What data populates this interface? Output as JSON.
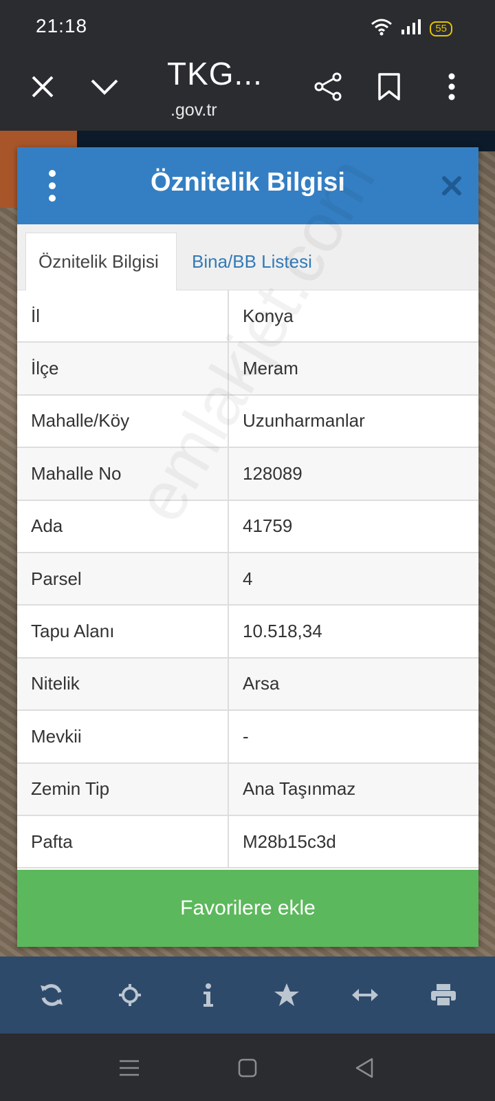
{
  "status": {
    "time": "21:18",
    "battery": "55"
  },
  "browser": {
    "title": "TKG...",
    "url": ".gov.tr"
  },
  "modal": {
    "title": "Öznitelik Bilgisi",
    "tabs": [
      {
        "label": "Öznitelik Bilgisi",
        "active": true
      },
      {
        "label": "Bina/BB Listesi",
        "active": false
      }
    ],
    "rows": [
      {
        "label": "İl",
        "value": "Konya"
      },
      {
        "label": "İlçe",
        "value": "Meram"
      },
      {
        "label": "Mahalle/Köy",
        "value": "Uzunharmanlar"
      },
      {
        "label": "Mahalle No",
        "value": "128089"
      },
      {
        "label": "Ada",
        "value": "41759"
      },
      {
        "label": "Parsel",
        "value": "4"
      },
      {
        "label": "Tapu Alanı",
        "value": "10.518,34"
      },
      {
        "label": "Nitelik",
        "value": "Arsa"
      },
      {
        "label": "Mevkii",
        "value": "-"
      },
      {
        "label": "Zemin Tip",
        "value": "Ana Taşınmaz"
      },
      {
        "label": "Pafta",
        "value": "M28b15c3d"
      }
    ],
    "favorite_button": "Favorilere ekle"
  },
  "watermark": "emlakjet.com",
  "toolbar": {
    "icons": [
      "refresh-icon",
      "crosshair-icon",
      "info-icon",
      "star-icon",
      "arrows-horizontal-icon",
      "print-icon"
    ]
  },
  "colors": {
    "header_blue": "#347fc3",
    "tab_link": "#337ab7",
    "favorite_green": "#5cb85c",
    "toolbar_bg": "#2e4a6b"
  }
}
